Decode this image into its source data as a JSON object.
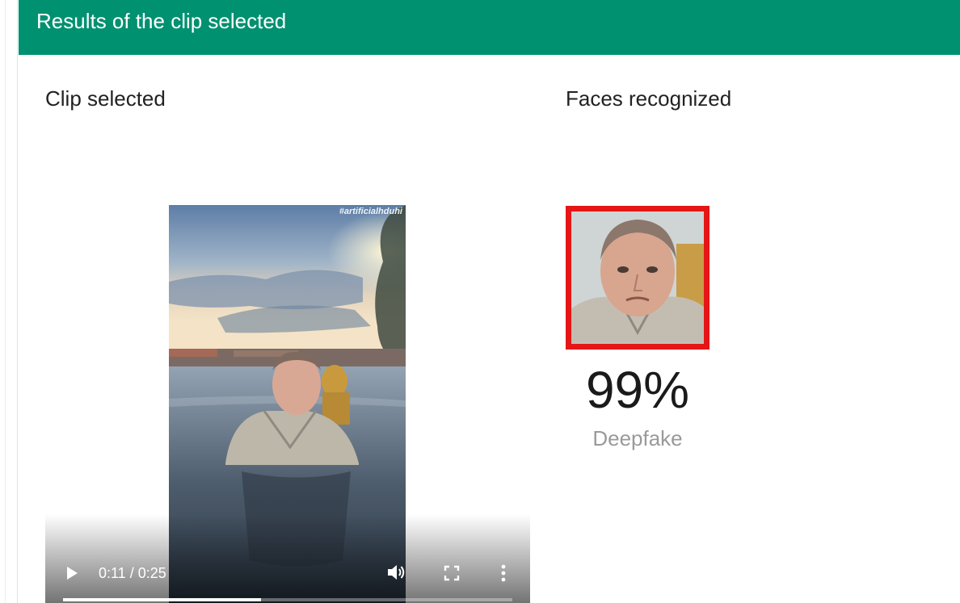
{
  "panel": {
    "title": "Results of the clip selected",
    "header_color": "#009170"
  },
  "clip": {
    "heading": "Clip selected",
    "watermark": "#artificialhduhi",
    "player": {
      "time_display": "0:11 / 0:25",
      "progress_fraction": 0.44,
      "icons": [
        "play-icon",
        "volume-icon",
        "fullscreen-icon",
        "more-vert-icon"
      ]
    }
  },
  "faces": {
    "heading": "Faces recognized",
    "items": [
      {
        "score": "99%",
        "label": "Deepfake",
        "border_color": "#e51616"
      }
    ]
  }
}
